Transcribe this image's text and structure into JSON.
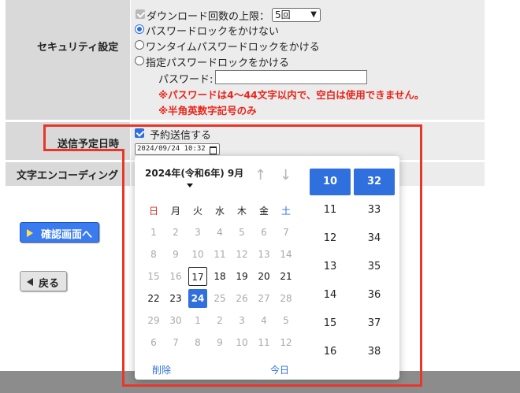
{
  "security": {
    "label": "セキュリティ設定",
    "download_limit_label": "ダウンロード回数の上限：",
    "download_limit_value": "5回",
    "options": [
      {
        "label": "パスワードロックをかけない",
        "selected": true
      },
      {
        "label": "ワンタイムパスワードロックをかける",
        "selected": false
      },
      {
        "label": "指定パスワードロックをかける",
        "selected": false
      }
    ],
    "password_label": "パスワード:",
    "password_value": "",
    "notes": [
      "※パスワードは4〜44文字以内で、空白は使用できません。",
      "※半角英数字記号のみ"
    ]
  },
  "schedule": {
    "label": "送信予定日時",
    "checkbox_label": "予約送信する",
    "checkbox_checked": true,
    "datetime_value": "2024/09/24 10:32"
  },
  "encoding": {
    "label": "文字エンコーディング"
  },
  "buttons": {
    "confirm": "確認画面へ",
    "back": "戻る"
  },
  "picker": {
    "month_title": "2024年(令和6年) 9月",
    "weekdays": [
      "日",
      "月",
      "火",
      "水",
      "木",
      "金",
      "土"
    ],
    "weeks": [
      [
        [
          "1",
          "out"
        ],
        [
          "2",
          "out"
        ],
        [
          "3",
          "out"
        ],
        [
          "4",
          "out"
        ],
        [
          "5",
          "out"
        ],
        [
          "6",
          "out"
        ],
        [
          "7",
          "out"
        ]
      ],
      [
        [
          "8",
          "out"
        ],
        [
          "9",
          "out"
        ],
        [
          "10",
          "out"
        ],
        [
          "11",
          "out"
        ],
        [
          "12",
          "out"
        ],
        [
          "13",
          "out"
        ],
        [
          "14",
          "out"
        ]
      ],
      [
        [
          "15",
          "out"
        ],
        [
          "16",
          "out"
        ],
        [
          "17",
          "today"
        ],
        [
          "18",
          "cur"
        ],
        [
          "19",
          "cur"
        ],
        [
          "20",
          "cur"
        ],
        [
          "21",
          "cur"
        ]
      ],
      [
        [
          "22",
          "cur"
        ],
        [
          "23",
          "cur"
        ],
        [
          "24",
          "sel"
        ],
        [
          "25",
          "out"
        ],
        [
          "26",
          "out"
        ],
        [
          "27",
          "out"
        ],
        [
          "28",
          "out"
        ]
      ],
      [
        [
          "29",
          "out"
        ],
        [
          "30",
          "out"
        ],
        [
          "1",
          "out"
        ],
        [
          "2",
          "out"
        ],
        [
          "3",
          "out"
        ],
        [
          "4",
          "out"
        ],
        [
          "5",
          "out"
        ]
      ],
      [
        [
          "6",
          "out"
        ],
        [
          "7",
          "out"
        ],
        [
          "8",
          "out"
        ],
        [
          "9",
          "out"
        ],
        [
          "10",
          "out"
        ],
        [
          "11",
          "out"
        ],
        [
          "12",
          "out"
        ]
      ]
    ],
    "hours": [
      "10",
      "11",
      "12",
      "13",
      "14",
      "15",
      "16"
    ],
    "minutes": [
      "32",
      "33",
      "34",
      "35",
      "36",
      "37",
      "38"
    ],
    "selected_hour": "10",
    "selected_minute": "32",
    "clear_label": "削除",
    "today_label": "今日"
  },
  "colors": {
    "accent": "#2f6fde",
    "warning": "#e8261c",
    "highlight": "#e8362a",
    "sunday": "#d9302a",
    "saturday": "#2f6fde"
  }
}
